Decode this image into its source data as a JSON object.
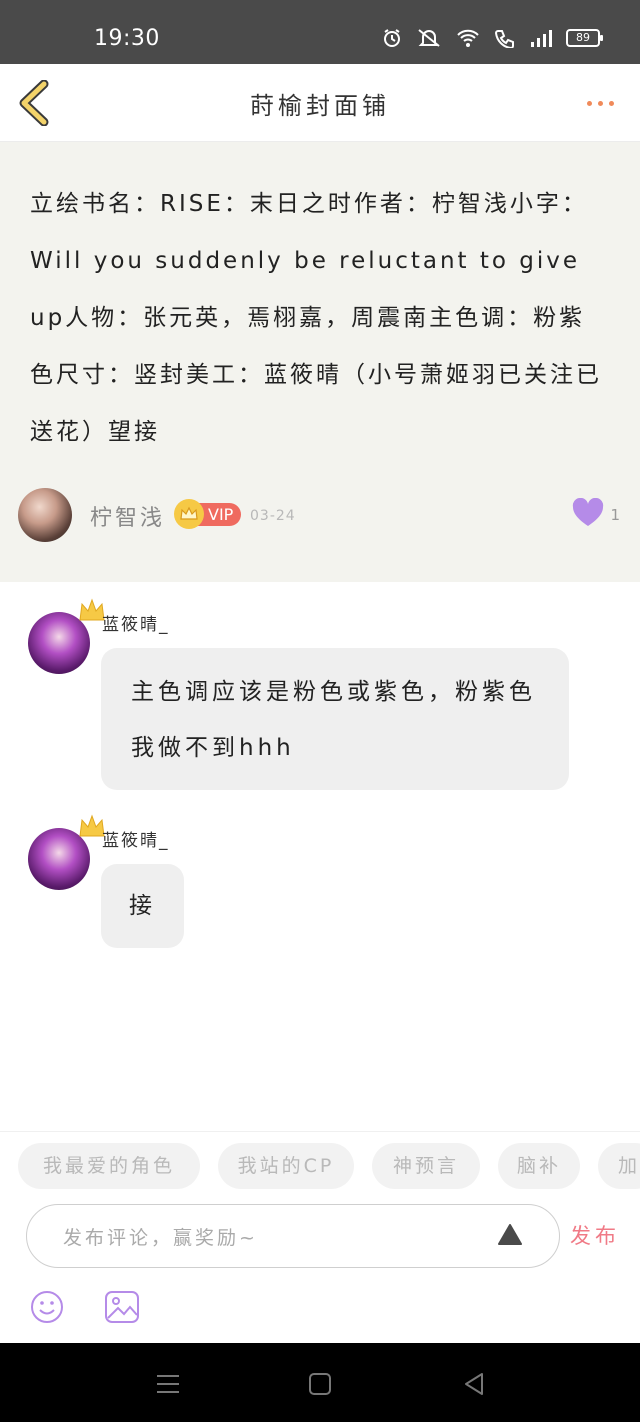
{
  "status_bar": {
    "time": "19:30",
    "battery": "89"
  },
  "header": {
    "title": "莳榆封面铺"
  },
  "post": {
    "text": "立绘书名：RISE：末日之时作者：柠智浅小字：Will you suddenly be reluctant to give up人物：张元英，焉栩嘉，周震南主色调：粉紫色尺寸：竖封美工：蓝筱晴（小号萧姬羽已关注已送花）望接",
    "author": "柠智浅",
    "vip_label": "VIP",
    "date": "03-24",
    "likes": "1"
  },
  "comments": [
    {
      "name": "蓝筱晴_",
      "text": "主色调应该是粉色或紫色，粉紫色我做不到hhh"
    },
    {
      "name": "蓝筱晴_",
      "text": "接"
    }
  ],
  "tags": [
    "我最爱的角色",
    "我站的CP",
    "神预言",
    "脑补",
    "加"
  ],
  "input": {
    "placeholder": "发布评论，赢奖励~",
    "send_label": "发布"
  },
  "colors": {
    "accent": "#f07a86",
    "like": "#b58be8",
    "vip": "#ef6a5f",
    "more_dots": "#f08a5a"
  },
  "icons": [
    "back-icon",
    "more-icon",
    "heart-icon",
    "crown-icon",
    "up-arrow-icon",
    "emoji-icon",
    "image-icon",
    "menu-icon",
    "home-icon",
    "back-triangle-icon"
  ]
}
